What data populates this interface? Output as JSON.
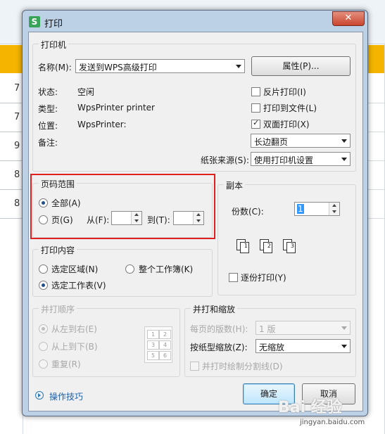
{
  "dialog": {
    "title": "打印",
    "app_icon_letter": "S",
    "close_label": "✕"
  },
  "background_sheet": {
    "row_numbers": [
      "7",
      "7",
      "9",
      "8",
      "8"
    ]
  },
  "printer": {
    "group_label": "打印机",
    "name_label": "名称(M):",
    "name_value": "发送到WPS高级打印",
    "properties_button": "属性(P)...",
    "status_label": "状态:",
    "status_value": "空闲",
    "type_label": "类型:",
    "type_value": "WpsPrinter printer",
    "location_label": "位置:",
    "location_value": "WpsPrinter:",
    "comment_label": "备注:",
    "reverse_print": {
      "label": "反片打印(I)",
      "checked": false
    },
    "print_to_file": {
      "label": "打印到文件(L)",
      "checked": false
    },
    "duplex": {
      "label": "双面打印(X)",
      "checked": true
    },
    "duplex_mode_value": "长边翻页",
    "paper_source_label": "纸张来源(S):",
    "paper_source_value": "使用打印机设置"
  },
  "page_range": {
    "group_label": "页码范围",
    "all_label": "全部(A)",
    "all_selected": true,
    "pages_label": "页(G)",
    "from_label": "从(F):",
    "from_value": "",
    "to_label": "到(T):",
    "to_value": ""
  },
  "copies": {
    "group_label": "副本",
    "count_label": "份数(C):",
    "count_value": "1",
    "collate": {
      "label": "逐份打印(Y)",
      "checked": false
    }
  },
  "print_content": {
    "group_label": "打印内容",
    "selection_label": "选定区域(N)",
    "workbook_label": "整个工作簿(K)",
    "sheet_label": "选定工作表(V)",
    "selected": "sheet"
  },
  "print_order": {
    "group_label": "并打顺序",
    "left_to_right": "从左到右(E)",
    "top_to_bottom": "从上到下(B)",
    "repeat": "重复(R)",
    "grid_numbers": [
      "1",
      "2",
      "3",
      "4",
      "5",
      "6"
    ]
  },
  "zoom": {
    "group_label": "并打和缩放",
    "pages_per_sheet_label": "每页的版数(H):",
    "pages_per_sheet_value": "1 版",
    "scale_label": "按纸型缩放(Z):",
    "scale_value": "无缩放",
    "draw_divider": {
      "label": "并打时绘制分割线(D)",
      "checked": false
    }
  },
  "footer": {
    "tips_link": "操作技巧",
    "ok_button": "确定",
    "cancel_button": "取消"
  },
  "watermark": {
    "brand": "Bai 经验",
    "url": "jingyan.baidu.com"
  },
  "colors": {
    "highlight_box": "#e02020",
    "title_bar": "#bcd0e6",
    "link": "#1f5fa8"
  }
}
